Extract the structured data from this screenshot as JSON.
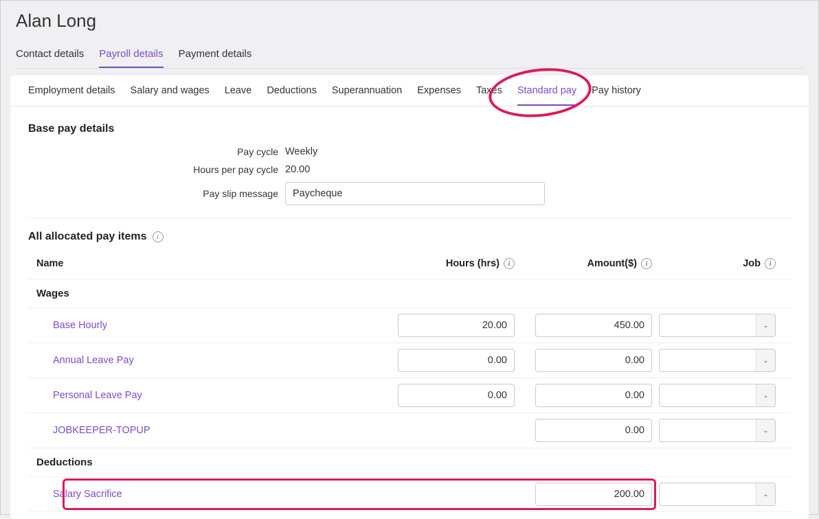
{
  "page_title": "Alan Long",
  "top_tabs": [
    {
      "label": "Contact details",
      "active": false
    },
    {
      "label": "Payroll details",
      "active": true
    },
    {
      "label": "Payment details",
      "active": false
    }
  ],
  "sub_tabs": [
    {
      "label": "Employment details",
      "active": false
    },
    {
      "label": "Salary and wages",
      "active": false
    },
    {
      "label": "Leave",
      "active": false
    },
    {
      "label": "Deductions",
      "active": false
    },
    {
      "label": "Superannuation",
      "active": false
    },
    {
      "label": "Expenses",
      "active": false
    },
    {
      "label": "Taxes",
      "active": false
    },
    {
      "label": "Standard pay",
      "active": true
    },
    {
      "label": "Pay history",
      "active": false
    }
  ],
  "base_pay": {
    "title": "Base pay details",
    "pay_cycle_label": "Pay cycle",
    "pay_cycle_value": "Weekly",
    "hours_label": "Hours per pay cycle",
    "hours_value": "20.00",
    "message_label": "Pay slip message",
    "message_value": "Paycheque"
  },
  "allocated": {
    "title": "All allocated pay items",
    "columns": {
      "name": "Name",
      "hours": "Hours (hrs)",
      "amount": "Amount($)",
      "job": "Job"
    },
    "groups": [
      {
        "label": "Wages",
        "rows": [
          {
            "name": "Base Hourly",
            "hours": "20.00",
            "amount": "450.00",
            "job": "",
            "highlight": false,
            "show_hours": true
          },
          {
            "name": "Annual Leave Pay",
            "hours": "0.00",
            "amount": "0.00",
            "job": "",
            "highlight": false,
            "show_hours": true
          },
          {
            "name": "Personal Leave Pay",
            "hours": "0.00",
            "amount": "0.00",
            "job": "",
            "highlight": false,
            "show_hours": true
          },
          {
            "name": "JOBKEEPER-TOPUP",
            "hours": "",
            "amount": "0.00",
            "job": "",
            "highlight": false,
            "show_hours": false
          }
        ]
      },
      {
        "label": "Deductions",
        "rows": [
          {
            "name": "Salary Sacrifice",
            "hours": "",
            "amount": "200.00",
            "job": "",
            "highlight": true,
            "show_hours": false
          }
        ]
      }
    ]
  }
}
